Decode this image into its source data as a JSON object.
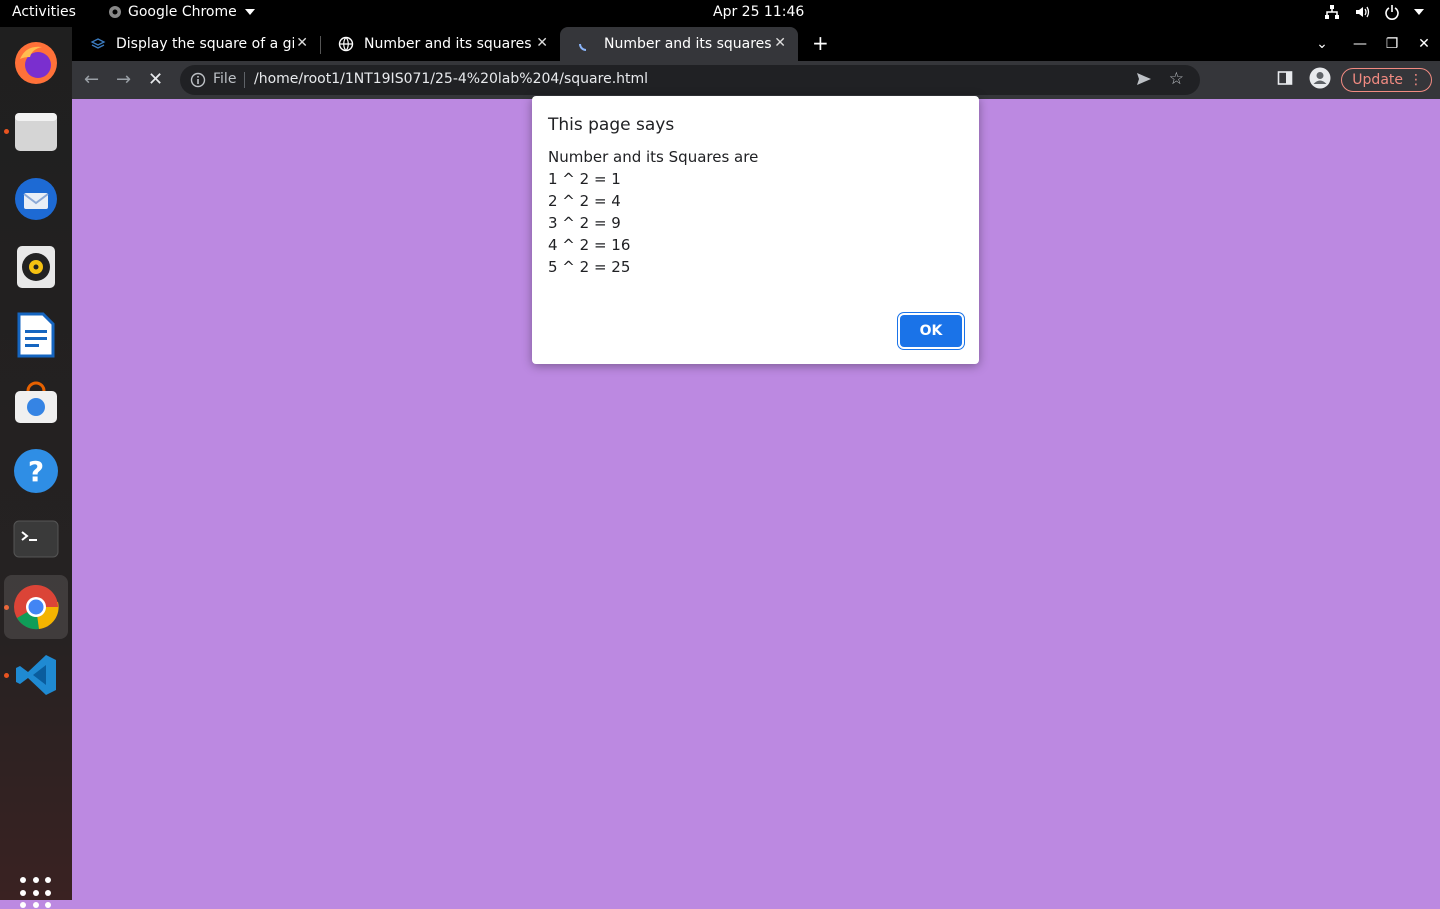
{
  "topbar": {
    "activities": "Activities",
    "app_name": "Google Chrome",
    "clock": "Apr 25  11:46"
  },
  "dock": {
    "items": [
      "firefox-icon",
      "files-icon",
      "thunderbird-icon",
      "rhythmbox-icon",
      "writer-icon",
      "software-icon",
      "help-icon",
      "terminal-icon",
      "chrome-icon",
      "vscode-icon"
    ]
  },
  "tabs": [
    {
      "title": "Display the square of a gi"
    },
    {
      "title": "Number and its squares"
    },
    {
      "title": "Number and its squares"
    }
  ],
  "omnibox": {
    "scheme": "File",
    "url": "/home/root1/1NT19IS071/25-4%20lab%204/square.html"
  },
  "toolbar": {
    "update_label": "Update"
  },
  "colors": {
    "page_background": "#bc89e1",
    "accent": "#1a73e8"
  },
  "dialog": {
    "title": "This page says",
    "lines": [
      "Number and its Squares are",
      "1 ^ 2 = 1",
      "2 ^ 2 = 4",
      "3 ^ 2 = 9",
      "4 ^ 2 = 16",
      "5 ^ 2 = 25"
    ],
    "ok_label": "OK"
  }
}
